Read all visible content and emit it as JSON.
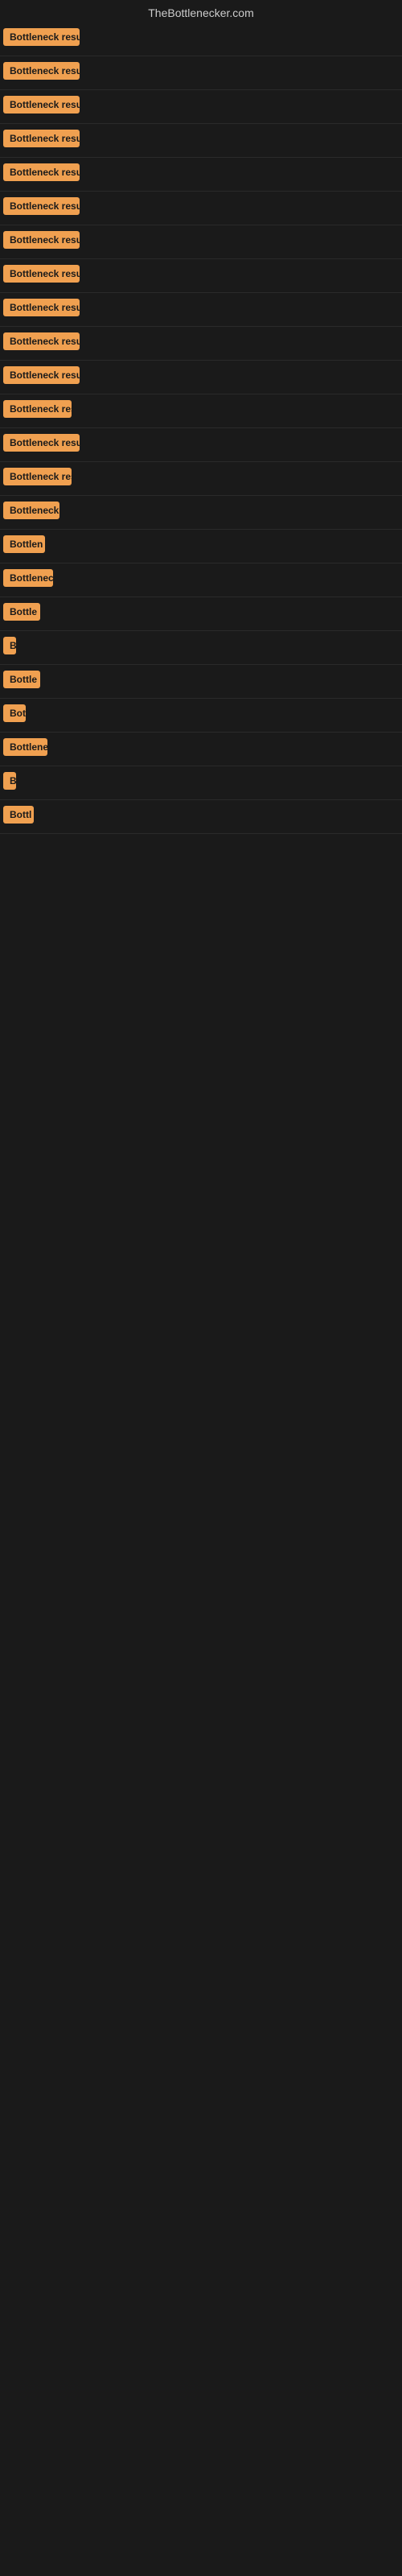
{
  "site": {
    "title": "TheBottlenecker.com"
  },
  "results": [
    {
      "id": 1,
      "label": "Bottleneck result",
      "width": 95
    },
    {
      "id": 2,
      "label": "Bottleneck result",
      "width": 95
    },
    {
      "id": 3,
      "label": "Bottleneck result",
      "width": 95
    },
    {
      "id": 4,
      "label": "Bottleneck result",
      "width": 95
    },
    {
      "id": 5,
      "label": "Bottleneck result",
      "width": 95
    },
    {
      "id": 6,
      "label": "Bottleneck result",
      "width": 95
    },
    {
      "id": 7,
      "label": "Bottleneck result",
      "width": 95
    },
    {
      "id": 8,
      "label": "Bottleneck result",
      "width": 95
    },
    {
      "id": 9,
      "label": "Bottleneck result",
      "width": 95
    },
    {
      "id": 10,
      "label": "Bottleneck result",
      "width": 95
    },
    {
      "id": 11,
      "label": "Bottleneck result",
      "width": 95
    },
    {
      "id": 12,
      "label": "Bottleneck resu",
      "width": 85
    },
    {
      "id": 13,
      "label": "Bottleneck result",
      "width": 95
    },
    {
      "id": 14,
      "label": "Bottleneck resu",
      "width": 85
    },
    {
      "id": 15,
      "label": "Bottleneck r",
      "width": 70
    },
    {
      "id": 16,
      "label": "Bottlen",
      "width": 52
    },
    {
      "id": 17,
      "label": "Bottleneck",
      "width": 62
    },
    {
      "id": 18,
      "label": "Bottle",
      "width": 46
    },
    {
      "id": 19,
      "label": "B",
      "width": 14
    },
    {
      "id": 20,
      "label": "Bottle",
      "width": 46
    },
    {
      "id": 21,
      "label": "Bot",
      "width": 28
    },
    {
      "id": 22,
      "label": "Bottlene",
      "width": 55
    },
    {
      "id": 23,
      "label": "B",
      "width": 14
    },
    {
      "id": 24,
      "label": "Bottl",
      "width": 38
    }
  ]
}
